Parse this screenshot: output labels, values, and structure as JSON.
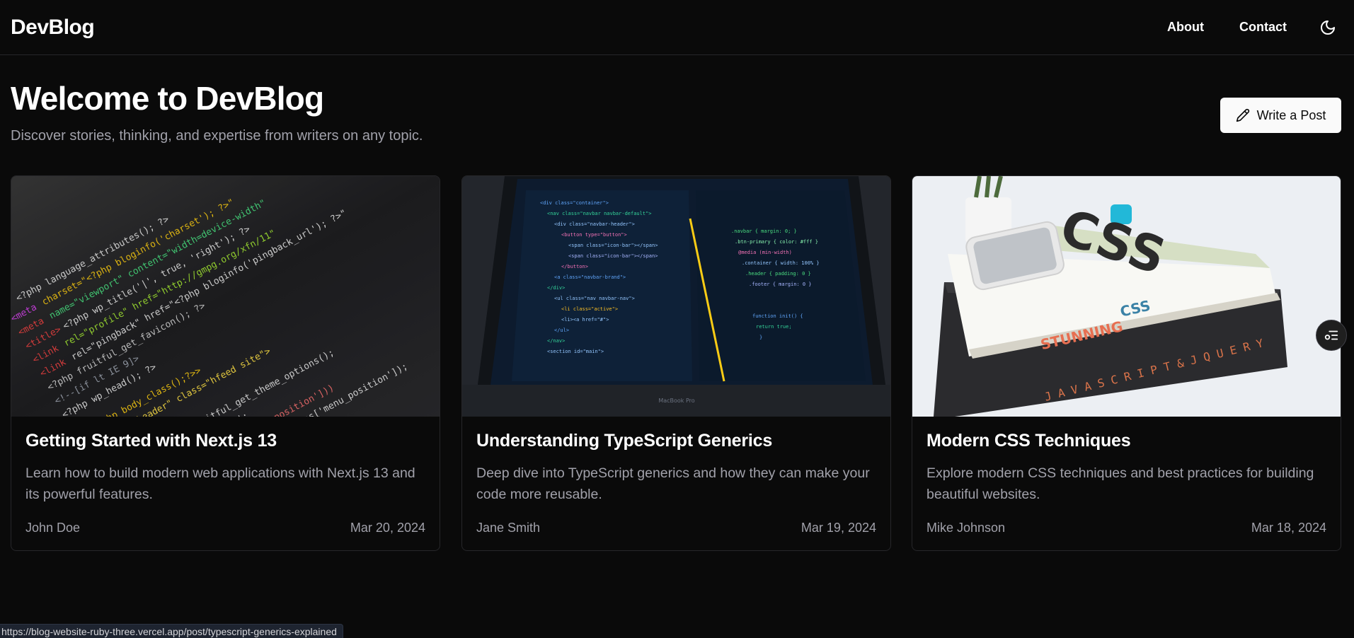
{
  "header": {
    "logo": "DevBlog",
    "nav": [
      "About",
      "Contact"
    ]
  },
  "hero": {
    "title": "Welcome to DevBlog",
    "subtitle": "Discover stories, thinking, and expertise from writers on any topic.",
    "write_button": "Write a Post"
  },
  "posts": [
    {
      "title": "Getting Started with Next.js 13",
      "excerpt": "Learn how to build modern web applications with Next.js 13 and its powerful features.",
      "author": "John Doe",
      "date": "Mar 20, 2024"
    },
    {
      "title": "Understanding TypeScript Generics",
      "excerpt": "Deep dive into TypeScript generics and how they can make your code more reusable.",
      "author": "Jane Smith",
      "date": "Mar 19, 2024"
    },
    {
      "title": "Modern CSS Techniques",
      "excerpt": "Explore modern CSS techniques and best practices for building beautiful websites.",
      "author": "Mike Johnson",
      "date": "Mar 18, 2024"
    }
  ],
  "status_bar": {
    "url": "https://blog-website-ruby-three.vercel.app/post/typescript-generics-explained"
  },
  "icons": {
    "theme_toggle": "moon-icon",
    "write": "pencil-icon",
    "floating": "list-filter-icon"
  },
  "colors": {
    "background": "#0a0a0a",
    "border": "#27272a",
    "muted_text": "#a1a1aa",
    "button_bg": "#fafafa"
  }
}
